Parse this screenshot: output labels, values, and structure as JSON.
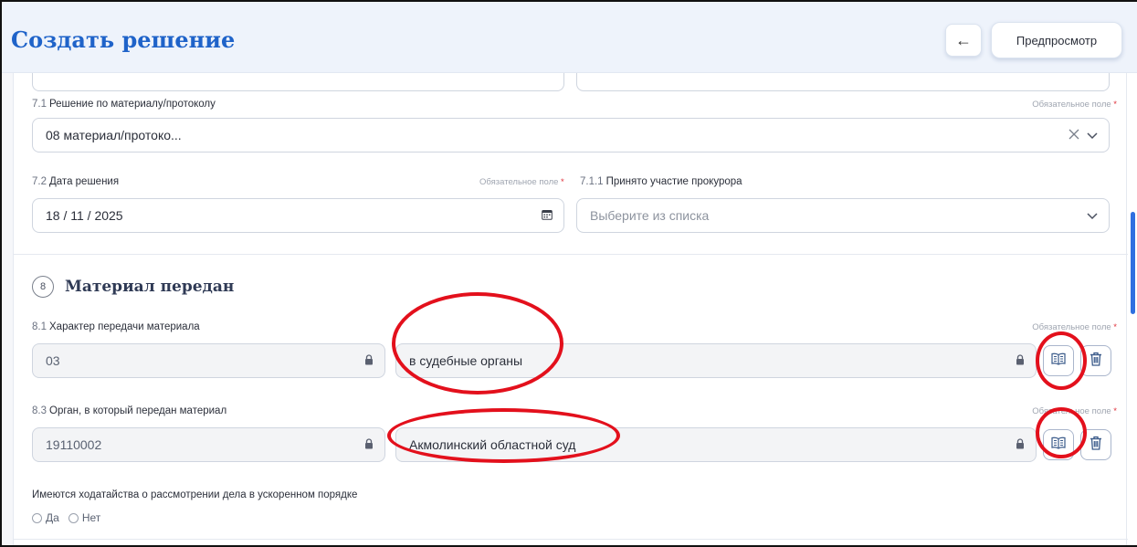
{
  "header": {
    "title": "Создать решение",
    "back_label": "←",
    "preview_label": "Предпросмотр"
  },
  "common": {
    "required_text": "Обязательное поле",
    "required_star": "*"
  },
  "section7": {
    "f71": {
      "num": "7.1",
      "label": "Решение по материалу/протоколу",
      "value": "08   материал/протоко..."
    },
    "f72": {
      "num": "7.2",
      "label": "Дата решения",
      "value": "18 / 11 / 2025"
    },
    "f711": {
      "num": "7.1.1",
      "label": "Принято участие прокурора",
      "placeholder": "Выберите из списка"
    }
  },
  "section8": {
    "number": "8",
    "title": "Материал передан",
    "f81": {
      "num": "8.1",
      "label": "Характер передачи материала",
      "code": "03",
      "name": "в судебные органы"
    },
    "f83": {
      "num": "8.3",
      "label": "Орган, в который передан материал",
      "code": "19110002",
      "name": "Акмолинский областной суд"
    },
    "petition": {
      "label": "Имеются ходатайства о рассмотрении дела в ускоренном порядке",
      "yes": "Да",
      "no": "Нет"
    }
  },
  "icons": {
    "lock": "lock-icon",
    "dictionary": "book-icon",
    "delete": "trash-icon",
    "calendar": "calendar-icon",
    "clear": "close-icon",
    "chevron": "chevron-down-icon"
  },
  "colors": {
    "title_blue": "#1f63c9",
    "header_bg": "#eef3fb",
    "required_red": "#e0313b",
    "annotation_red": "#e3101c",
    "scroll_blue": "#2f6fe0"
  }
}
